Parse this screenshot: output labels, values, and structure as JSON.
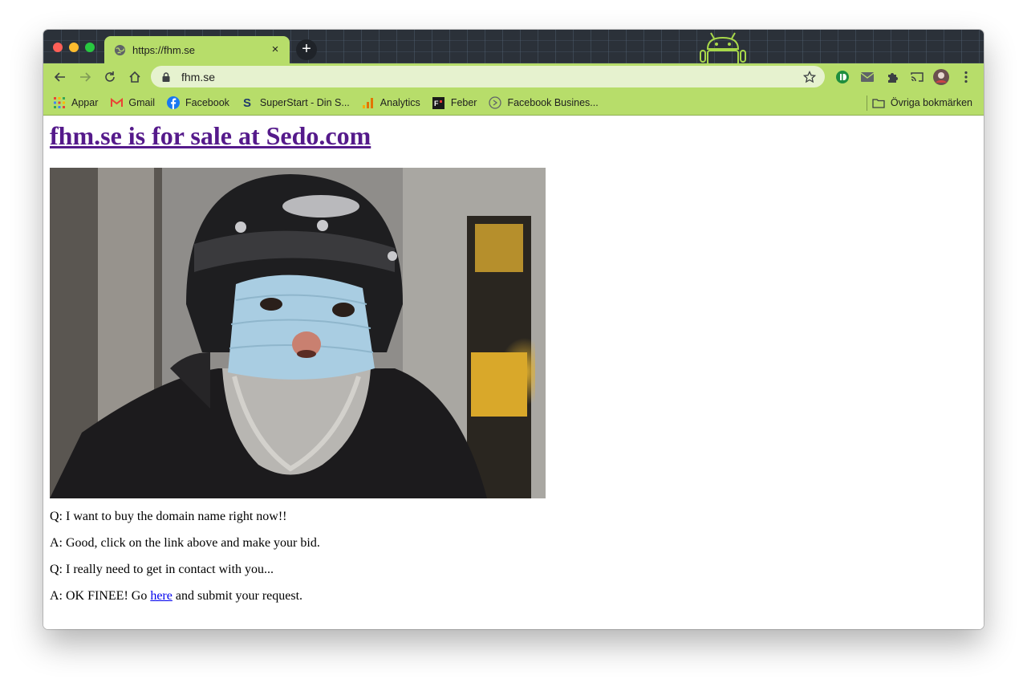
{
  "browser": {
    "tab_title": "https://fhm.se",
    "tab_close": "×",
    "new_tab": "+",
    "url": "fhm.se"
  },
  "bookmarks": {
    "items": [
      {
        "label": "Appar",
        "icon": "apps-grid-icon"
      },
      {
        "label": "Gmail",
        "icon": "gmail-icon"
      },
      {
        "label": "Facebook",
        "icon": "facebook-icon"
      },
      {
        "label": "SuperStart - Din S...",
        "icon": "superstart-icon"
      },
      {
        "label": "Analytics",
        "icon": "analytics-icon"
      },
      {
        "label": "Feber",
        "icon": "feber-icon"
      },
      {
        "label": "Facebook Busines...",
        "icon": "facebook-business-icon"
      }
    ],
    "other": "Övriga bokmärken"
  },
  "page": {
    "headline": "fhm.se is for sale at Sedo.com",
    "q1": "Q: I want to buy the domain name right now!!",
    "a1": "A: Good, click on the link above and make your bid.",
    "q2": "Q: I really need to get in contact with you...",
    "a2_prefix": "A: OK FINEE! Go ",
    "a2_link": "here",
    "a2_suffix": " and submit your request."
  },
  "colors": {
    "theme_green": "#b7dd6a",
    "tabstrip_dark": "#2b3139",
    "visited_link": "#551a8b",
    "link": "#0000ee"
  }
}
